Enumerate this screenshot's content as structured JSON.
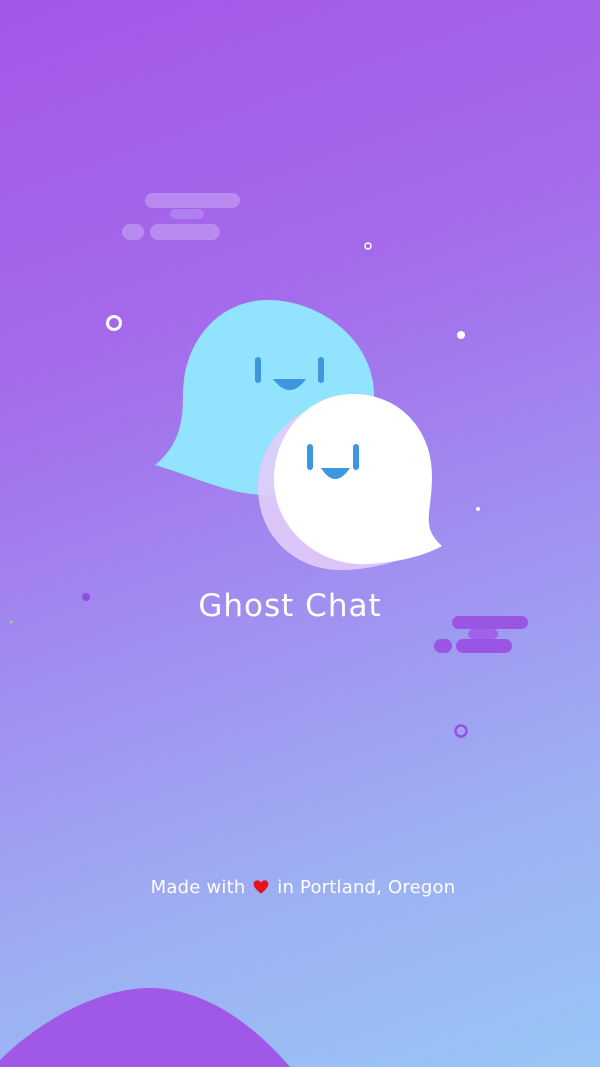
{
  "app": {
    "title": "Ghost Chat"
  },
  "footer": {
    "made_with": "Made with",
    "location": "in Portland, Oregon"
  },
  "icons": {
    "heart": "heart-icon",
    "ghost_blue": "ghost-bubble-blue-icon",
    "ghost_white": "ghost-bubble-white-icon"
  },
  "colors": {
    "background_top": "#a457e8",
    "background_bottom": "#98c6f6",
    "ghost_blue": "#92e3fd",
    "ghost_white": "#ffffff",
    "face": "#3d96e0",
    "heart": "#e8121a",
    "hill": "#a058e6"
  }
}
